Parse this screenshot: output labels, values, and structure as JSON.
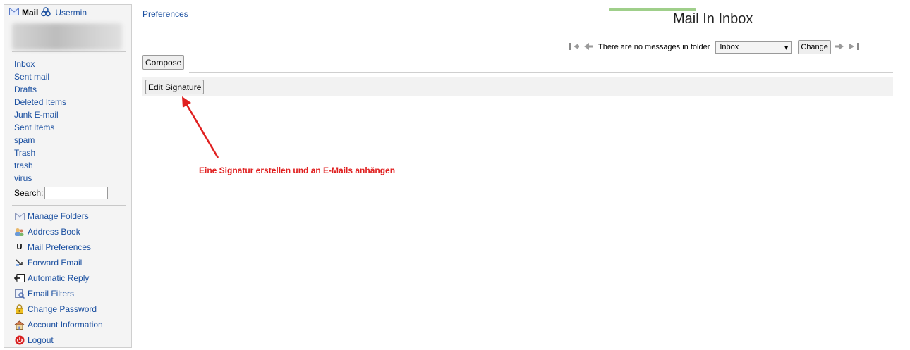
{
  "sidebar": {
    "app_title": "Mail",
    "usermin_link": "Usermin",
    "folders": [
      "Inbox",
      "Sent mail",
      "Drafts",
      "Deleted Items",
      "Junk E-mail",
      "Sent Items",
      "spam",
      "Trash",
      "trash",
      "virus"
    ],
    "search_label": "Search:",
    "search_value": "",
    "tools": [
      {
        "label": "Manage Folders",
        "icon": "folder-manage-icon"
      },
      {
        "label": "Address Book",
        "icon": "address-book-icon"
      },
      {
        "label": "Mail Preferences",
        "icon": "preferences-icon"
      },
      {
        "label": "Forward Email",
        "icon": "forward-icon"
      },
      {
        "label": "Automatic Reply",
        "icon": "auto-reply-icon"
      },
      {
        "label": "Email Filters",
        "icon": "filter-icon"
      },
      {
        "label": "Change Password",
        "icon": "lock-icon"
      },
      {
        "label": "Account Information",
        "icon": "account-icon"
      },
      {
        "label": "Logout",
        "icon": "logout-icon"
      }
    ]
  },
  "header": {
    "preferences_link": "Preferences",
    "title": "Mail In Inbox"
  },
  "nav": {
    "status_text": "There are no messages in folder",
    "selected_folder": "Inbox",
    "change_label": "Change"
  },
  "actions": {
    "compose_label": "Compose",
    "edit_signature_label": "Edit Signature"
  },
  "annotation": {
    "text": "Eine Signatur erstellen und an E-Mails anhängen",
    "color": "#e02020"
  },
  "colors": {
    "link": "#1a4fa0",
    "accent_bar": "#9fcf8a"
  }
}
